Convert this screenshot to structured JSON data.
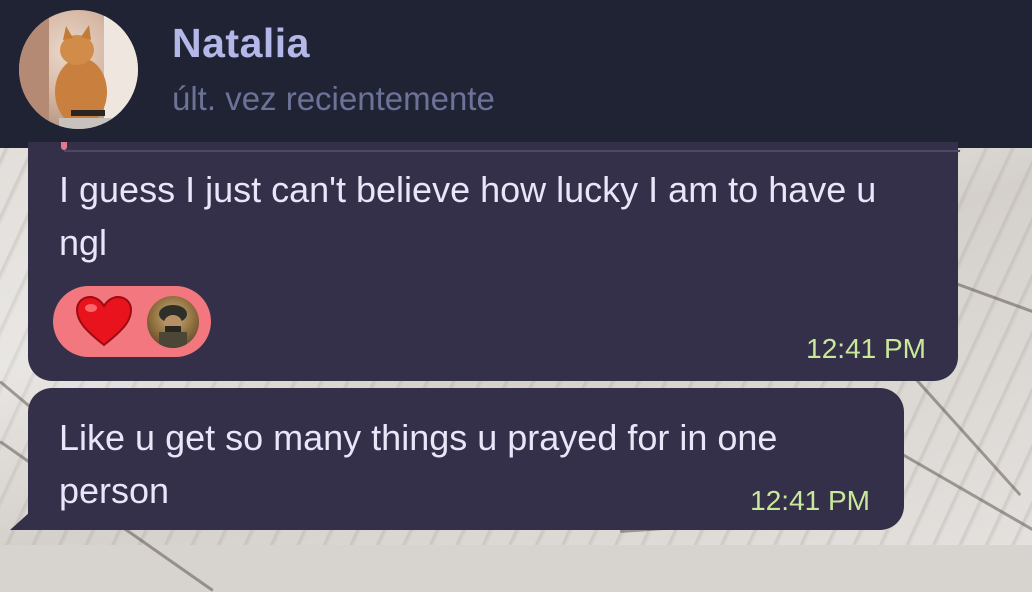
{
  "header": {
    "contact_name": "Natalia",
    "status": "últ. vez recientemente"
  },
  "messages": [
    {
      "text": "I guess I just can't believe how lucky I am to have u ngl",
      "time": "12:41 PM",
      "reaction": {
        "emoji_icon": "red-heart-icon",
        "emoji": "❤️"
      }
    },
    {
      "text": "Like u get so many things u prayed for in one person",
      "time": "12:41 PM"
    }
  ],
  "colors": {
    "header_bg": "#1f2333",
    "name": "#b3b8e8",
    "status": "#6d7398",
    "bubble": "#343049",
    "message_text": "#e8e6f8",
    "time": "#c8e89a",
    "reaction_bg": "#f2777f"
  }
}
